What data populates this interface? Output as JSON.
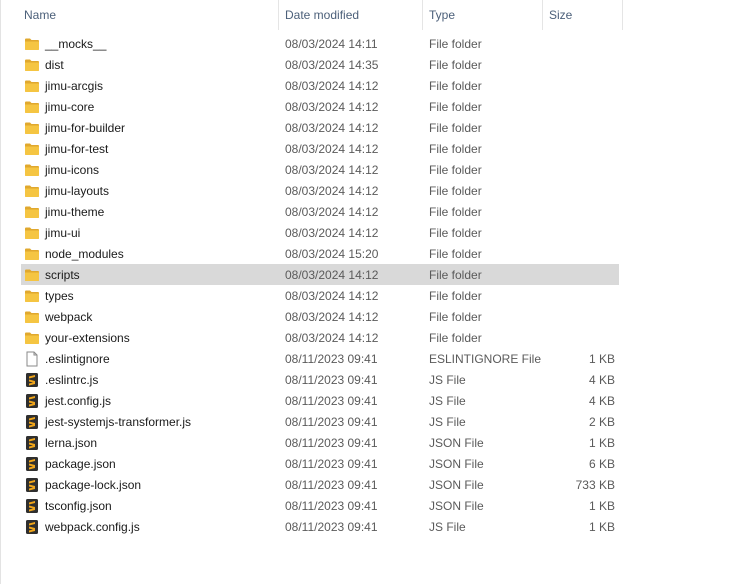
{
  "header": {
    "name": "Name",
    "date": "Date modified",
    "type": "Type",
    "size": "Size",
    "sort_arrow": "^"
  },
  "colors": {
    "folder": "#f5c542",
    "folder_dark": "#e0a82e",
    "js_icon_bg": "#2f2f2f",
    "js_icon_accent": "#f0a51a",
    "selected_row": "#d9d9d9"
  },
  "files": [
    {
      "name": "__mocks__",
      "date": "08/03/2024 14:11",
      "type": "File folder",
      "size": "",
      "icon": "folder-icon"
    },
    {
      "name": "dist",
      "date": "08/03/2024 14:35",
      "type": "File folder",
      "size": "",
      "icon": "folder-icon"
    },
    {
      "name": "jimu-arcgis",
      "date": "08/03/2024 14:12",
      "type": "File folder",
      "size": "",
      "icon": "folder-icon"
    },
    {
      "name": "jimu-core",
      "date": "08/03/2024 14:12",
      "type": "File folder",
      "size": "",
      "icon": "folder-icon"
    },
    {
      "name": "jimu-for-builder",
      "date": "08/03/2024 14:12",
      "type": "File folder",
      "size": "",
      "icon": "folder-icon"
    },
    {
      "name": "jimu-for-test",
      "date": "08/03/2024 14:12",
      "type": "File folder",
      "size": "",
      "icon": "folder-icon"
    },
    {
      "name": "jimu-icons",
      "date": "08/03/2024 14:12",
      "type": "File folder",
      "size": "",
      "icon": "folder-icon"
    },
    {
      "name": "jimu-layouts",
      "date": "08/03/2024 14:12",
      "type": "File folder",
      "size": "",
      "icon": "folder-icon"
    },
    {
      "name": "jimu-theme",
      "date": "08/03/2024 14:12",
      "type": "File folder",
      "size": "",
      "icon": "folder-icon"
    },
    {
      "name": "jimu-ui",
      "date": "08/03/2024 14:12",
      "type": "File folder",
      "size": "",
      "icon": "folder-icon"
    },
    {
      "name": "node_modules",
      "date": "08/03/2024 15:20",
      "type": "File folder",
      "size": "",
      "icon": "folder-icon"
    },
    {
      "name": "scripts",
      "date": "08/03/2024 14:12",
      "type": "File folder",
      "size": "",
      "icon": "folder-icon",
      "selected": true
    },
    {
      "name": "types",
      "date": "08/03/2024 14:12",
      "type": "File folder",
      "size": "",
      "icon": "folder-icon"
    },
    {
      "name": "webpack",
      "date": "08/03/2024 14:12",
      "type": "File folder",
      "size": "",
      "icon": "folder-icon"
    },
    {
      "name": "your-extensions",
      "date": "08/03/2024 14:12",
      "type": "File folder",
      "size": "",
      "icon": "folder-icon"
    },
    {
      "name": ".eslintignore",
      "date": "08/11/2023 09:41",
      "type": "ESLINTIGNORE File",
      "size": "1 KB",
      "icon": "blank-file-icon"
    },
    {
      "name": ".eslintrc.js",
      "date": "08/11/2023 09:41",
      "type": "JS File",
      "size": "4 KB",
      "icon": "code-file-icon"
    },
    {
      "name": "jest.config.js",
      "date": "08/11/2023 09:41",
      "type": "JS File",
      "size": "4 KB",
      "icon": "code-file-icon"
    },
    {
      "name": "jest-systemjs-transformer.js",
      "date": "08/11/2023 09:41",
      "type": "JS File",
      "size": "2 KB",
      "icon": "code-file-icon"
    },
    {
      "name": "lerna.json",
      "date": "08/11/2023 09:41",
      "type": "JSON File",
      "size": "1 KB",
      "icon": "code-file-icon"
    },
    {
      "name": "package.json",
      "date": "08/11/2023 09:41",
      "type": "JSON File",
      "size": "6 KB",
      "icon": "code-file-icon"
    },
    {
      "name": "package-lock.json",
      "date": "08/11/2023 09:41",
      "type": "JSON File",
      "size": "733 KB",
      "icon": "code-file-icon"
    },
    {
      "name": "tsconfig.json",
      "date": "08/11/2023 09:41",
      "type": "JSON File",
      "size": "1 KB",
      "icon": "code-file-icon"
    },
    {
      "name": "webpack.config.js",
      "date": "08/11/2023 09:41",
      "type": "JS File",
      "size": "1 KB",
      "icon": "code-file-icon"
    }
  ]
}
